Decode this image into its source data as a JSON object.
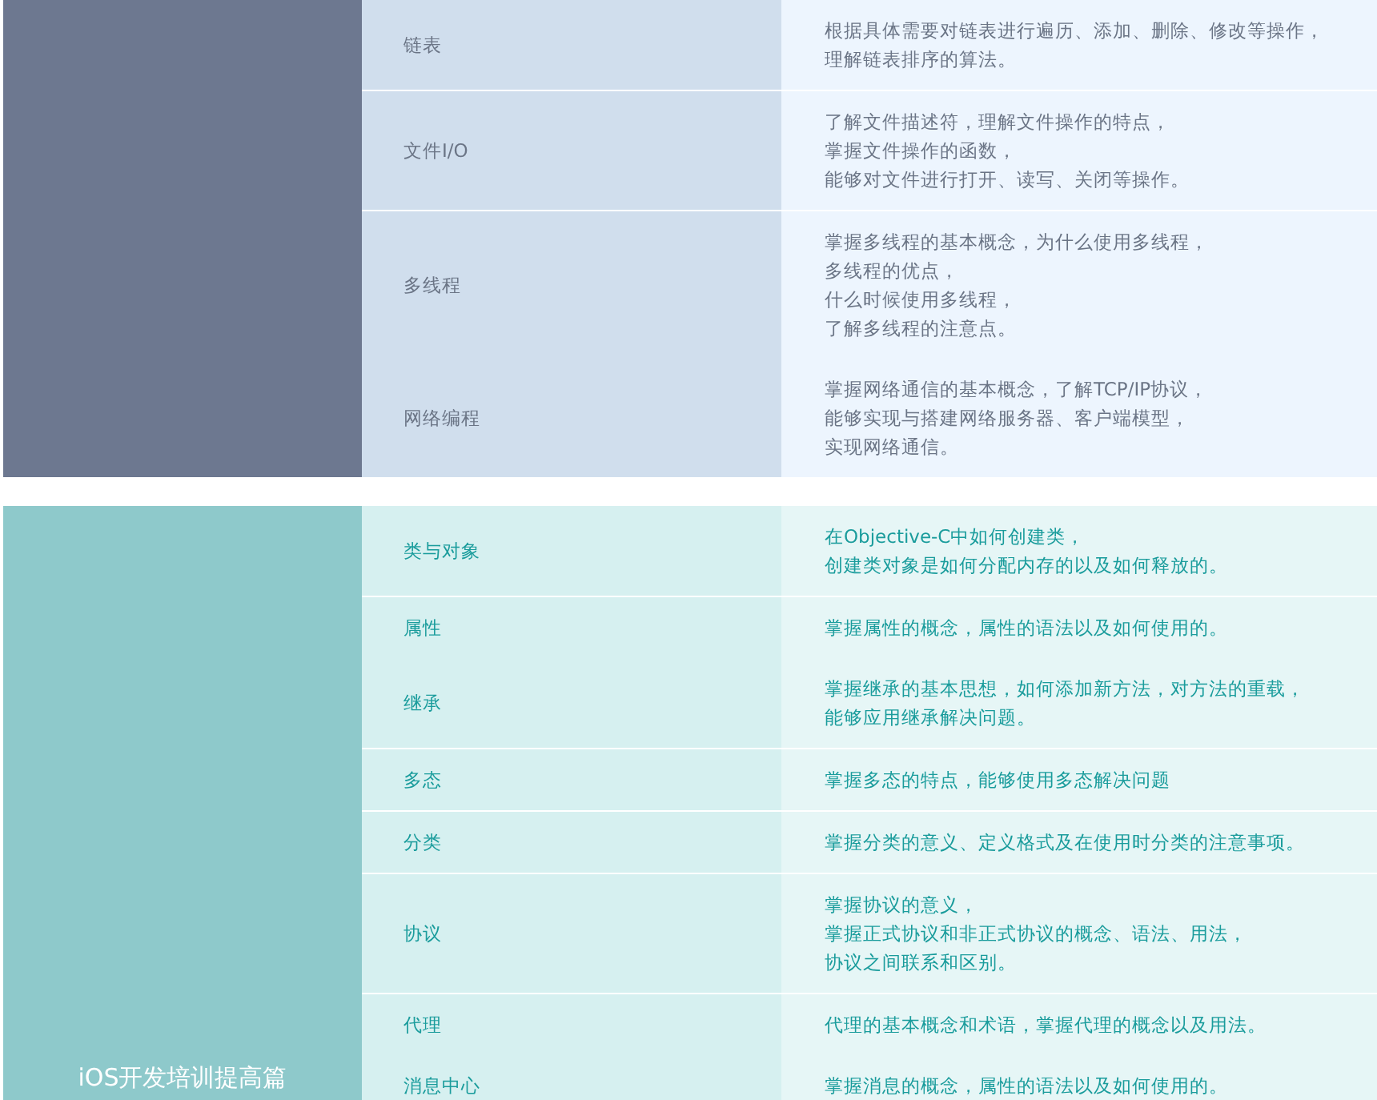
{
  "sections": [
    {
      "color": "#6d7890",
      "groups": [
        {
          "items": [
            {
              "topic": "链表",
              "description": [
                "根据具体需要对链表进行遍历、添加、删除、修改等操作，",
                "理解链表排序的算法。"
              ]
            }
          ]
        },
        {
          "items": [
            {
              "topic": "文件I/O",
              "description": [
                "了解文件描述符，理解文件操作的特点，",
                "掌握文件操作的函数，",
                "能够对文件进行打开、读写、关闭等操作。"
              ]
            }
          ]
        },
        {
          "items": [
            {
              "topic": "多线程",
              "description": [
                "掌握多线程的基本概念，为什么使用多线程，",
                "多线程的优点，",
                "什么时候使用多线程，",
                "了解多线程的注意点。"
              ]
            },
            {
              "topic": "网络编程",
              "description": [
                "掌握网络通信的基本概念，了解TCP/IP协议，",
                "能够实现与搭建网络服务器、客户端模型，",
                "实现网络通信。"
              ]
            }
          ]
        }
      ]
    },
    {
      "color": "#8ec9cb",
      "title": "iOS开发培训提高篇",
      "groups": [
        {
          "items": [
            {
              "topic": "类与对象",
              "description": [
                "在Objective-C中如何创建类，",
                "创建类对象是如何分配内存的以及如何释放的。"
              ]
            }
          ]
        },
        {
          "items": [
            {
              "topic": "属性",
              "description": [
                "掌握属性的概念，属性的语法以及如何使用的。"
              ]
            },
            {
              "topic": "继承",
              "description": [
                "掌握继承的基本思想，如何添加新方法，对方法的重载，",
                "能够应用继承解决问题。"
              ]
            }
          ]
        },
        {
          "items": [
            {
              "topic": "多态",
              "description": [
                "掌握多态的特点，能够使用多态解决问题"
              ]
            }
          ]
        },
        {
          "items": [
            {
              "topic": "分类",
              "description": [
                "掌握分类的意义、定义格式及在使用时分类的注意事项。"
              ]
            }
          ]
        },
        {
          "items": [
            {
              "topic": "协议",
              "description": [
                "掌握协议的意义，",
                "掌握正式协议和非正式协议的概念、语法、用法，",
                "协议之间联系和区别。"
              ]
            }
          ]
        },
        {
          "items": [
            {
              "topic": "代理",
              "description": [
                "代理的基本概念和术语，掌握代理的概念以及用法。"
              ]
            },
            {
              "topic": "消息中心",
              "description": [
                "掌握消息的概念，属性的语法以及如何使用的。"
              ]
            }
          ]
        }
      ]
    }
  ]
}
